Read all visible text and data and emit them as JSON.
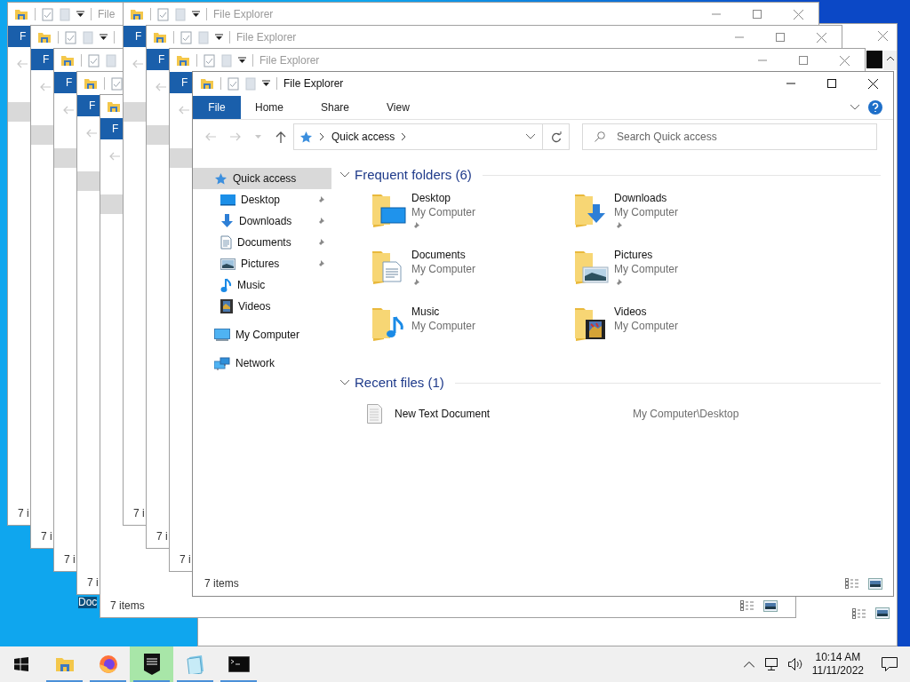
{
  "desktop": {
    "icons": [
      {
        "label": "Doc",
        "selected": true
      }
    ]
  },
  "background_windows": [
    {
      "title": "File",
      "file_tab": "F",
      "status": "7 i"
    },
    {
      "file_tab": "F",
      "status": "7 i"
    },
    {
      "file_tab": "F",
      "status": "7 i"
    },
    {
      "file_tab": "F",
      "status": "7 i"
    },
    {
      "file_tab": "F",
      "status": "7 items"
    },
    {
      "title": "File Explorer",
      "file_tab": "F",
      "status": "7 i"
    },
    {
      "title": "File Explorer",
      "file_tab": "F",
      "status": "7 i"
    },
    {
      "title": "File Explorer",
      "file_tab": "F",
      "status": "7 i"
    }
  ],
  "window": {
    "title": "File Explorer",
    "ribbon_tabs": [
      {
        "label": "File",
        "selected": true
      },
      {
        "label": "Home",
        "selected": false
      },
      {
        "label": "Share",
        "selected": false
      },
      {
        "label": "View",
        "selected": false
      }
    ],
    "address": {
      "path": [
        "Quick access"
      ]
    },
    "search": {
      "placeholder": "Search Quick access"
    },
    "nav": [
      {
        "label": "Quick access",
        "kind": "star",
        "selected": true,
        "children": [
          {
            "label": "Desktop",
            "kind": "desktop",
            "pinned": true,
            "selected": false
          },
          {
            "label": "Downloads",
            "kind": "downloads",
            "pinned": true,
            "selected": false
          },
          {
            "label": "Documents",
            "kind": "documents",
            "pinned": true,
            "selected": false
          },
          {
            "label": "Pictures",
            "kind": "pictures",
            "pinned": true,
            "selected": false
          },
          {
            "label": "Music",
            "kind": "music",
            "pinned": false,
            "selected": false
          },
          {
            "label": "Videos",
            "kind": "videos",
            "pinned": false,
            "selected": false
          }
        ]
      },
      {
        "label": "My Computer",
        "kind": "computer",
        "selected": false
      },
      {
        "label": "Network",
        "kind": "network",
        "selected": false
      }
    ],
    "sections": [
      {
        "title": "Frequent folders (6)",
        "expanded": true,
        "kind": "folders",
        "items": [
          {
            "name": "Desktop",
            "location": "My Computer",
            "kind": "desktop",
            "pinned": true
          },
          {
            "name": "Downloads",
            "location": "My Computer",
            "kind": "downloads",
            "pinned": true
          },
          {
            "name": "Documents",
            "location": "My Computer",
            "kind": "documents",
            "pinned": true
          },
          {
            "name": "Pictures",
            "location": "My Computer",
            "kind": "pictures",
            "pinned": true
          },
          {
            "name": "Music",
            "location": "My Computer",
            "kind": "music",
            "pinned": false
          },
          {
            "name": "Videos",
            "location": "My Computer",
            "kind": "videos",
            "pinned": false
          }
        ]
      },
      {
        "title": "Recent files (1)",
        "expanded": true,
        "kind": "files",
        "items": [
          {
            "name": "New Text Document",
            "location": "My Computer\\Desktop",
            "kind": "text"
          }
        ]
      }
    ],
    "status": "7 items"
  },
  "taskbar": {
    "apps": [
      {
        "kind": "explorer",
        "running": true,
        "highlighted": false
      },
      {
        "kind": "firefox",
        "running": true,
        "highlighted": false
      },
      {
        "kind": "epic",
        "running": true,
        "highlighted": true
      },
      {
        "kind": "notepad",
        "running": true,
        "highlighted": false
      },
      {
        "kind": "terminal",
        "running": true,
        "highlighted": false
      }
    ],
    "clock": {
      "time": "10:14 AM",
      "date": "11/11/2022"
    }
  }
}
